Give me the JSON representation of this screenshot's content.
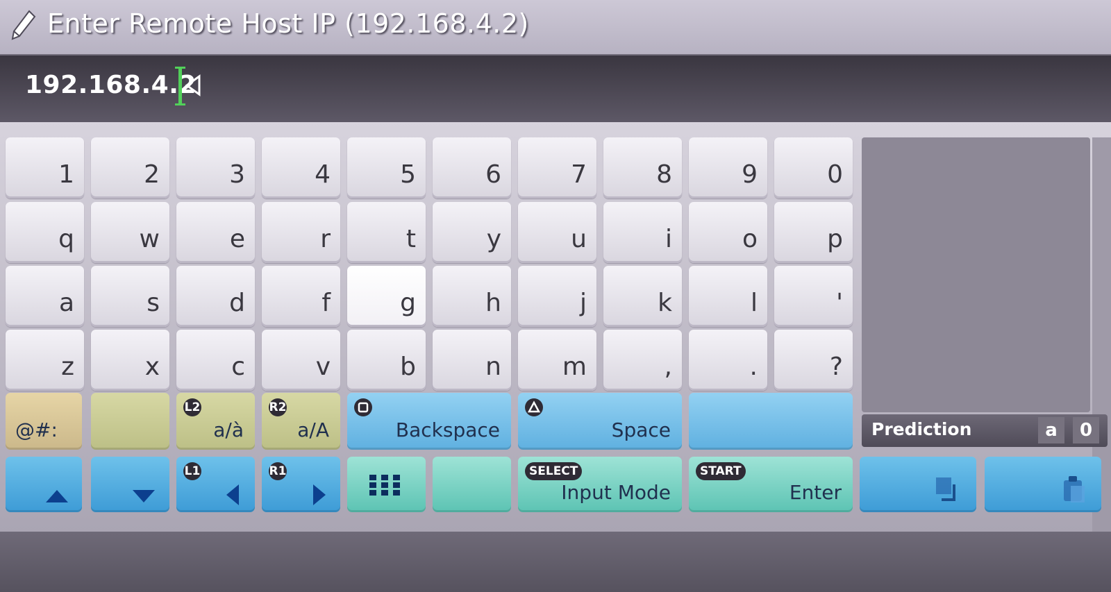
{
  "dialog": {
    "title": "Enter Remote Host IP (192.168.4.2)",
    "input_value": "192.168.4.2"
  },
  "keyboard": {
    "rows": [
      [
        "1",
        "2",
        "3",
        "4",
        "5",
        "6",
        "7",
        "8",
        "9",
        "0"
      ],
      [
        "q",
        "w",
        "e",
        "r",
        "t",
        "y",
        "u",
        "i",
        "o",
        "p"
      ],
      [
        "a",
        "s",
        "d",
        "f",
        "g",
        "h",
        "j",
        "k",
        "l",
        "'"
      ],
      [
        "z",
        "x",
        "c",
        "v",
        "b",
        "n",
        "m",
        ",",
        ".",
        "?"
      ]
    ],
    "highlighted_key": "g"
  },
  "function_keys": {
    "symbols": "@#:",
    "accent_toggle": {
      "badge": "L2",
      "label": "a/à"
    },
    "case_toggle": {
      "badge": "R2",
      "label": "a/A"
    },
    "backspace": {
      "label": "Backspace"
    },
    "space": {
      "label": "Space"
    },
    "cursor_left": {
      "badge": "L1"
    },
    "cursor_right": {
      "badge": "R1"
    },
    "input_mode": {
      "badge": "SELECT",
      "label": "Input Mode"
    },
    "enter": {
      "badge": "START",
      "label": "Enter"
    }
  },
  "prediction": {
    "label": "Prediction",
    "mode_a": "a",
    "mode_0": "0"
  },
  "colors": {
    "caret": "#52d05a",
    "symbol_key": "#e6d5a6",
    "blue_key": "#93d1f2",
    "teal_key": "#9ee3d6"
  },
  "icons": [
    "pencil-icon",
    "caret-left-arrow-icon",
    "square-button-icon",
    "triangle-button-icon",
    "up-arrow-icon",
    "down-arrow-icon",
    "left-arrow-icon",
    "right-arrow-icon",
    "keypad-grid-icon",
    "copy-icon",
    "paste-icon"
  ]
}
